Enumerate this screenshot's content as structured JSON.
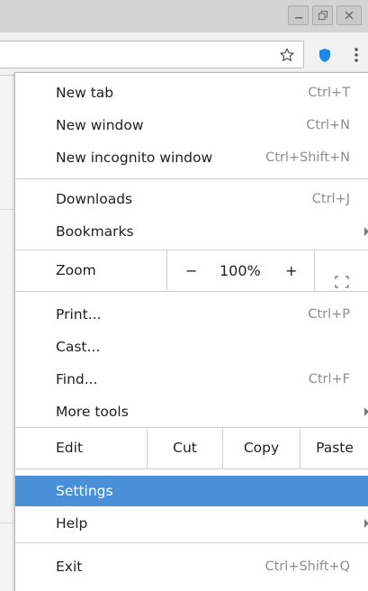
{
  "window": {
    "minimize_icon": "minimize-icon",
    "maximize_icon": "maximize-icon",
    "close_icon": "close-icon"
  },
  "toolbar": {
    "bookmark_icon": "star-icon",
    "extension_icon": "shield-icon",
    "menu_icon": "kebab-menu-icon",
    "extension_color": "#1a88e8"
  },
  "menu": {
    "group1": [
      {
        "label": "New tab",
        "shortcut": "Ctrl+T"
      },
      {
        "label": "New window",
        "shortcut": "Ctrl+N"
      },
      {
        "label": "New incognito window",
        "shortcut": "Ctrl+Shift+N"
      }
    ],
    "group2": [
      {
        "label": "Downloads",
        "shortcut": "Ctrl+J"
      },
      {
        "label": "Bookmarks",
        "shortcut": ""
      }
    ],
    "zoom": {
      "label": "Zoom",
      "minus": "−",
      "value": "100%",
      "plus": "+",
      "fullscreen_icon": "fullscreen-icon"
    },
    "group3": [
      {
        "label": "Print...",
        "shortcut": "Ctrl+P"
      },
      {
        "label": "Cast...",
        "shortcut": ""
      },
      {
        "label": "Find...",
        "shortcut": "Ctrl+F"
      },
      {
        "label": "More tools",
        "shortcut": ""
      }
    ],
    "edit": {
      "label": "Edit",
      "cut": "Cut",
      "copy": "Copy",
      "paste": "Paste"
    },
    "group4": [
      {
        "label": "Settings",
        "shortcut": ""
      },
      {
        "label": "Help",
        "shortcut": ""
      }
    ],
    "exit": {
      "label": "Exit",
      "shortcut": "Ctrl+Shift+Q"
    },
    "highlight_color": "#4a90d9"
  }
}
